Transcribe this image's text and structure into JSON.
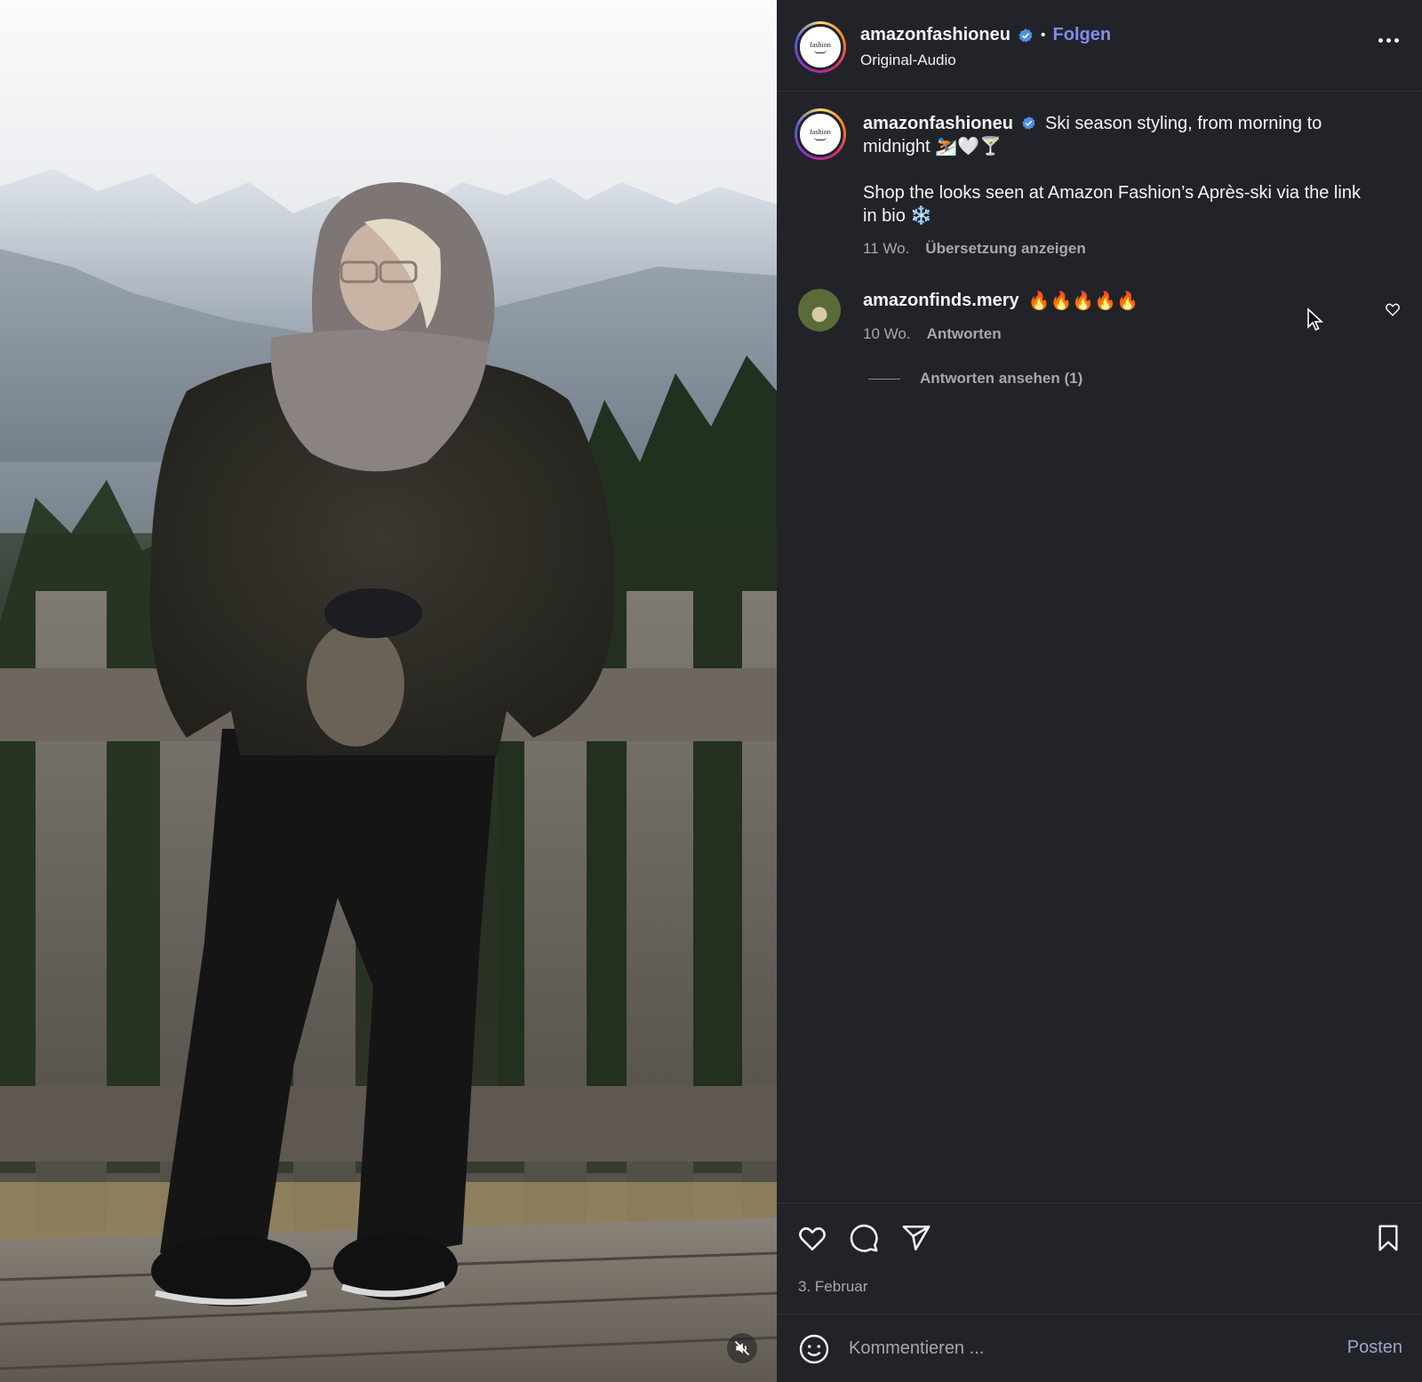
{
  "post": {
    "author": "amazonfashioneu",
    "follow_label": "Folgen",
    "separator": "•",
    "audio_label": "Original-Audio",
    "avatar_logo_text": "fashion"
  },
  "caption": {
    "author": "amazonfashioneu",
    "line1": "Ski season styling, from morning to midnight ⛷️🤍🍸",
    "line2": "Shop the looks seen at Amazon Fashion’s Après-ski via the link in bio ❄️",
    "age": "11 Wo.",
    "translate_label": "Übersetzung anzeigen"
  },
  "comments": [
    {
      "author": "amazonfinds.mery",
      "text": "🔥🔥🔥🔥🔥",
      "age": "10 Wo.",
      "reply_label": "Antworten",
      "view_replies_label": "Antworten ansehen (1)"
    }
  ],
  "footer": {
    "date": "3. Februar",
    "comment_placeholder": "Kommentieren ...",
    "post_label": "Posten"
  },
  "icons": {
    "verified": "verified-badge-icon",
    "more": "more-options-icon",
    "like": "heart-icon",
    "comment": "comment-bubble-icon",
    "share": "paper-plane-icon",
    "save": "bookmark-icon",
    "emoji": "emoji-smile-icon",
    "mute": "speaker-muted-icon"
  },
  "colors": {
    "background": "#212328",
    "follow": "#7f8cf0",
    "verified": "#4a90e2",
    "muted_text": "#a8a8a8"
  }
}
